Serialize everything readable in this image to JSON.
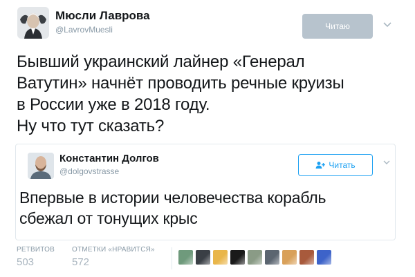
{
  "author": {
    "name": "Мюсли Лаврова",
    "handle": "@LavrovMuesli"
  },
  "follow_button": {
    "label": "Читаю",
    "state": "following"
  },
  "tweet": {
    "lines": [
      "Бывший украинский лайнер «Генерал",
      "Ватутин» начнёт проводить речные круизы",
      "в России уже в 2018 году.",
      "Ну что тут сказать?"
    ]
  },
  "quoted": {
    "name": "Константин Долгов",
    "handle": "@dolgovstrasse",
    "follow_label": "Читать",
    "lines": [
      "Впервые в истории человечества корабль",
      "сбежал от тонущих крыс"
    ]
  },
  "stats": {
    "retweets_label": "РЕТВИТОВ",
    "retweets": "503",
    "likes_label": "ОТМЕТКИ «НРАВИТСЯ»",
    "likes": "572"
  },
  "likers": [
    {
      "name": "liker-avatar-1",
      "color": "#6f9a7c"
    },
    {
      "name": "liker-avatar-2",
      "color": "#3a3f45"
    },
    {
      "name": "liker-avatar-3",
      "color": "#e9b64a"
    },
    {
      "name": "liker-avatar-4",
      "color": "#1a1a1a"
    },
    {
      "name": "liker-avatar-5",
      "color": "#8a9b86"
    },
    {
      "name": "liker-avatar-6",
      "color": "#5b6570"
    },
    {
      "name": "liker-avatar-7",
      "color": "#d9a15a"
    },
    {
      "name": "liker-avatar-8",
      "color": "#a85a3c"
    },
    {
      "name": "liker-avatar-9",
      "color": "#3d63c9"
    }
  ],
  "colors": {
    "accent": "#1da1f2",
    "muted": "#8899a6",
    "following_btn": "#b7c3cd"
  },
  "icons": {
    "caret": "chevron-down-icon",
    "follow": "follow-person-icon"
  }
}
